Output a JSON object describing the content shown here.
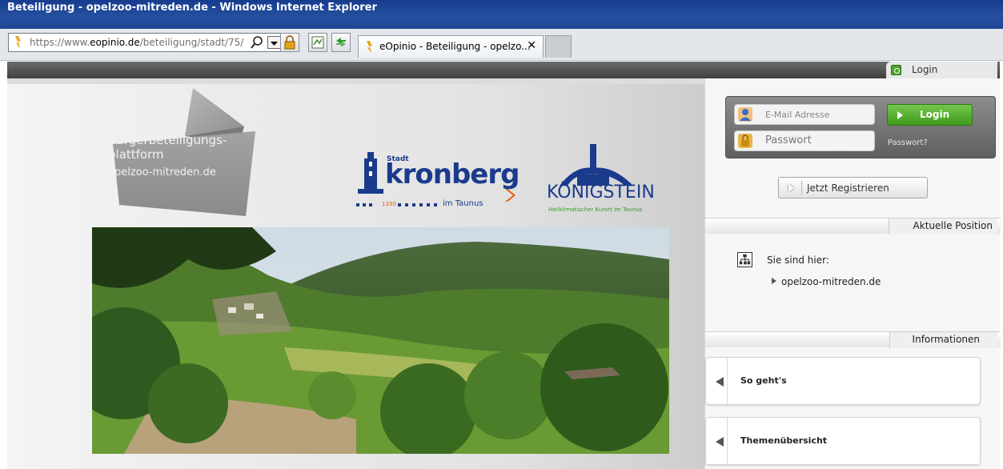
{
  "window": {
    "title": "Beteiligung - opelzoo-mitreden.de - Windows Internet Explorer"
  },
  "browser": {
    "url_prefix": "https://www.",
    "url_domain": "eopinio.de",
    "url_path": "/beteiligung/stadt/75/",
    "tab_title": "eOpinio - Beteiligung - opelzo...",
    "tab_close": "✕"
  },
  "header": {
    "login_tab_label": "Login",
    "platform_line1": "Bürgerbeteiligungs-",
    "platform_line2": "plattform",
    "platform_domain": "opelzoo-mitreden.de",
    "kronberg_stadt": "Stadt",
    "kronberg_name": "kronberg",
    "kronberg_year": "1330",
    "kronberg_sub": "im Taunus",
    "konig_name": "KÖNIGSTEIN",
    "konig_sub": "Heilklimatischer Kurort im Taunus"
  },
  "login": {
    "email_placeholder": "E-Mail Adresse",
    "password_placeholder": "Passwort",
    "login_button": "Login",
    "forgot_password": "Passwort?",
    "register_button": "Jetzt Registrieren"
  },
  "position": {
    "header": "Aktuelle Position",
    "you_are_here": "Sie sind hier:",
    "crumb": "opelzoo-mitreden.de"
  },
  "info": {
    "header": "Informationen",
    "items": [
      {
        "label": "So geht's"
      },
      {
        "label": "Themenübersicht"
      }
    ]
  },
  "colors": {
    "titlebar": "#1d4593",
    "login_green": "#4aa52c",
    "kronberg_blue": "#1a3b8c",
    "kronberg_orange": "#e8590c",
    "konig_blue": "#1a3b8c",
    "konig_green": "#3a9a2a"
  }
}
